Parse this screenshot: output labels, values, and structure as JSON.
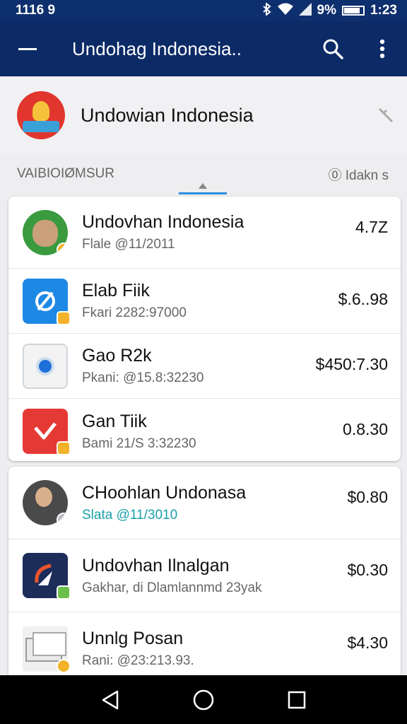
{
  "status_bar": {
    "time": "1116 9",
    "battery_text": "9%",
    "clock_right": "1:23",
    "icons": [
      "bluetooth-icon",
      "wifi-icon",
      "signal-icon",
      "battery-icon"
    ]
  },
  "app_bar": {
    "title": "Undohag Indonesia..",
    "icons": [
      "menu-icon",
      "search-icon",
      "more-vert-icon"
    ]
  },
  "profile": {
    "name": "Undowian Indonesia",
    "action_icon": "edit-icon"
  },
  "section": {
    "left_label": "VAIBIOIØMSUR",
    "right_label": "⓪ Idakn s"
  },
  "list_group_1": [
    {
      "title": "Undovhan Indonesia",
      "subtitle": "Flale @11/2011",
      "amount": "4.7Z",
      "icon": "monster-app-icon"
    },
    {
      "title": "Elab Fiik",
      "subtitle": "Fkari 2282:97000",
      "amount": "$.6..98",
      "icon": "blue-app-icon"
    },
    {
      "title": "Gao R2k",
      "subtitle": "Pkani: @15.8:32230",
      "amount": "$450:7.30",
      "icon": "camera-app-icon"
    },
    {
      "title": "Gan Tiik",
      "subtitle": "Bami 21/S 3:32230",
      "amount": "0.8.30",
      "icon": "red-app-icon"
    }
  ],
  "list_group_2": [
    {
      "title": "CHoohlan Undonasa",
      "subtitle": "Slata @11/3010",
      "amount": "$0.80",
      "icon": "photo-avatar-icon",
      "subtitle_color": "#1aa0a8"
    },
    {
      "title": "Undovhan Ilnalgan",
      "subtitle": "Gakhar, di Dlamlannmd 23yak",
      "amount": "$0.30",
      "icon": "navy-app-icon"
    },
    {
      "title": "Unnlg Posan",
      "subtitle": "Rani: @23:213.93.",
      "amount": "$4.30",
      "icon": "cash-app-icon"
    }
  ],
  "nav_bar": {
    "icons": [
      "back-icon",
      "home-icon",
      "recents-icon"
    ]
  },
  "colors": {
    "app_bar": "#0b2a66",
    "status_bar": "#0e2f6e",
    "accent": "#2a8de0",
    "teal_text": "#1aa0a8"
  }
}
